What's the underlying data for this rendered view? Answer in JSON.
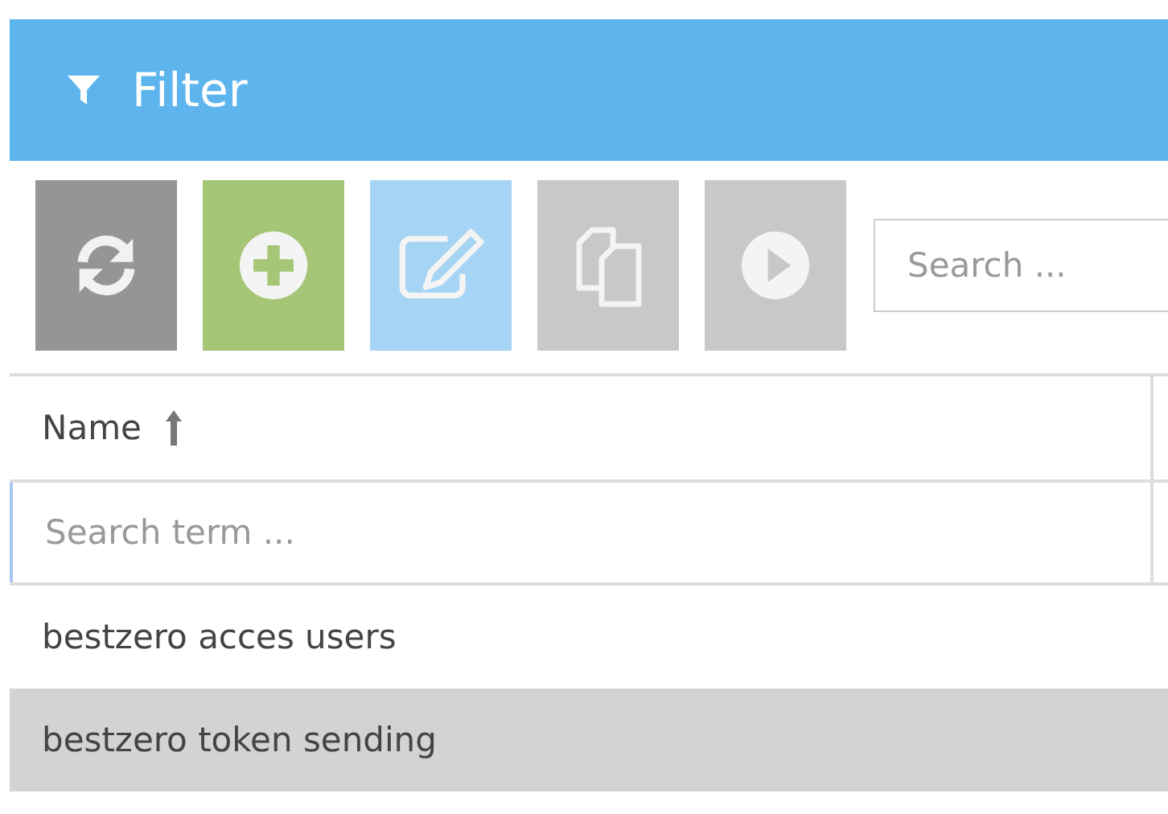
{
  "panel": {
    "title": "Filter"
  },
  "toolbar": {
    "buttons": [
      {
        "kind": "refresh",
        "disabled": false
      },
      {
        "kind": "add",
        "disabled": false
      },
      {
        "kind": "edit",
        "disabled": true
      },
      {
        "kind": "copy",
        "disabled": true
      },
      {
        "kind": "run",
        "disabled": true
      }
    ],
    "search": {
      "placeholder": "Search ..."
    }
  },
  "table": {
    "columns": [
      {
        "label": "Name",
        "sorted_ascending": true
      }
    ],
    "filter": {
      "placeholder": "Search term ..."
    },
    "rows": [
      {
        "name": "bestzero acces users",
        "selected": false
      },
      {
        "name": "bestzero token sending",
        "selected": true
      }
    ]
  }
}
